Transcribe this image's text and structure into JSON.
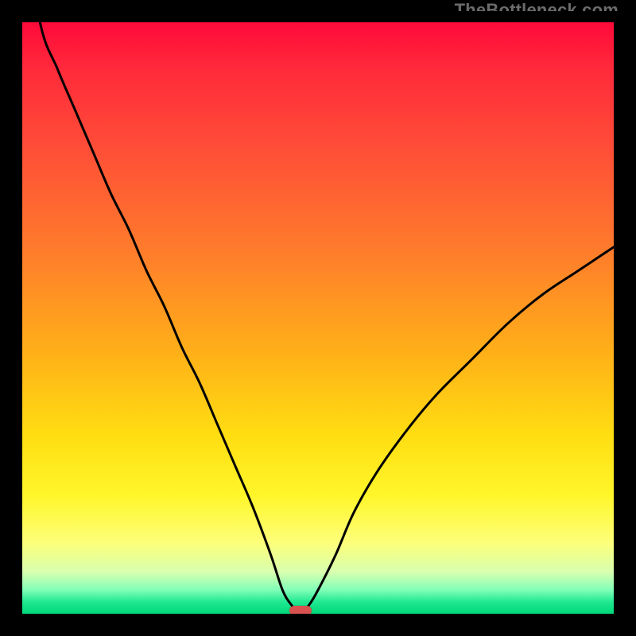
{
  "watermark": "TheBottleneck.com",
  "colors": {
    "top": "#ff0a3a",
    "mid": "#ffde12",
    "bottom": "#00d87a",
    "frame": "#000000",
    "curve": "#000000",
    "marker": "#d8534f"
  },
  "chart_data": {
    "type": "line",
    "title": "",
    "xlabel": "",
    "ylabel": "",
    "xlim": [
      0,
      100
    ],
    "ylim": [
      0,
      100
    ],
    "optimum_x": 47,
    "series": [
      {
        "name": "bottleneck-curve",
        "x": [
          0,
          3,
          6,
          9,
          12,
          15,
          18,
          21,
          24,
          27,
          30,
          33,
          36,
          39,
          42,
          44,
          45.5,
          47,
          48.5,
          50,
          53,
          56,
          60,
          65,
          70,
          76,
          82,
          88,
          94,
          100
        ],
        "values": [
          120,
          100,
          92,
          85,
          78,
          71,
          65,
          58,
          52,
          45,
          39,
          32,
          25,
          18,
          10,
          4,
          1.5,
          0,
          1.5,
          4,
          10,
          17,
          24,
          31,
          37,
          43,
          49,
          54,
          58,
          62
        ]
      }
    ],
    "grid": false,
    "legend": false,
    "marker": {
      "x": 47,
      "y": 0
    }
  }
}
